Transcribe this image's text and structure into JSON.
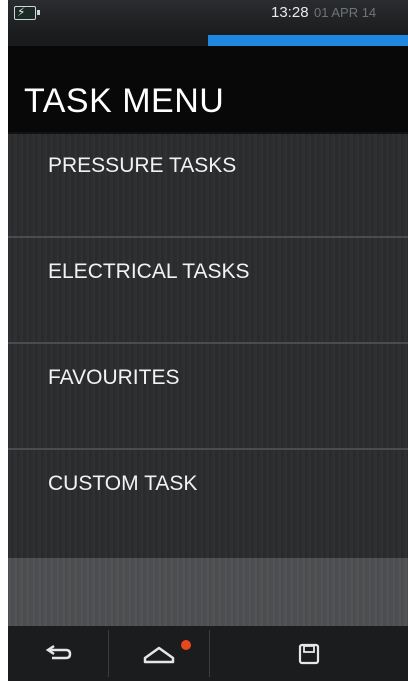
{
  "status_bar": {
    "time": "13:28",
    "date": "01 APR 14",
    "progress_fraction": 0.5
  },
  "header": {
    "title": "TASK MENU"
  },
  "menu": {
    "items": [
      {
        "label": "PRESSURE TASKS"
      },
      {
        "label": "ELECTRICAL TASKS"
      },
      {
        "label": "FAVOURITES"
      },
      {
        "label": "CUSTOM TASK"
      }
    ]
  },
  "bottom_nav": {
    "back_icon": "back-arrow-icon",
    "home_icon": "home-icon",
    "save_icon": "floppy-disk-icon",
    "notification_color": "#e9471e"
  },
  "colors": {
    "accent": "#1e87e0",
    "background": "#111214",
    "text": "#ffffff"
  }
}
